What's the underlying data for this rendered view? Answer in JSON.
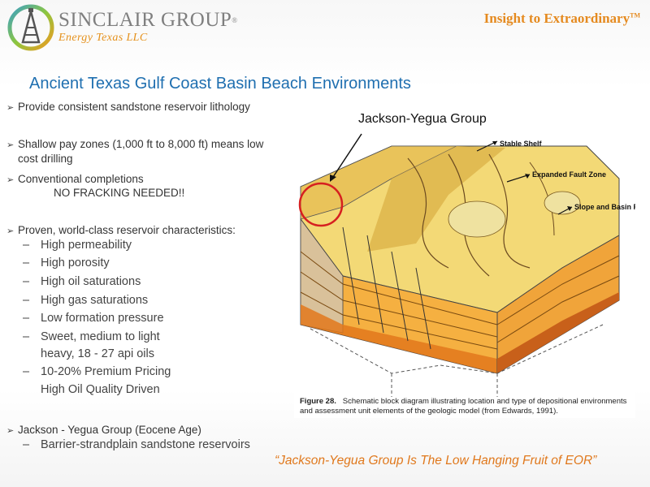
{
  "header": {
    "company_name": "SINCLAIR GROUP",
    "company_reg": "®",
    "company_sub": "Energy Texas LLC",
    "tagline": "Insight to Extraordinary",
    "tagline_tm": "TM"
  },
  "title": "Ancient Texas Gulf Coast Basin Beach Environments",
  "bullets": {
    "b1": "Provide consistent sandstone reservoir lithology",
    "b2_line1": "Shallow pay zones (1,000 ft to 8,000 ft) means low",
    "b2_line2": "cost drilling",
    "b3_line1": "Conventional completions",
    "b3_line2": "NO FRACKING NEEDED!!",
    "b4": "Proven, world-class reservoir characteristics:",
    "sub": [
      "High permeability",
      "High porosity",
      "High oil saturations",
      "High gas saturations",
      "Low formation pressure",
      "Sweet, medium to light",
      "heavy, 18 - 27 api oils",
      "10-20% Premium Pricing",
      "High Oil Quality Driven"
    ],
    "b5": "Jackson - Yegua Group (Eocene Age)",
    "b5_sub": "Barrier-strandplain sandstone reservoirs"
  },
  "figure": {
    "callout_label": "Jackson-Yegua Group",
    "labels": {
      "stable_shelf": "Stable Shelf",
      "expanded_fault_zone": "Expanded Fault Zone",
      "slope_basin_floor": "Slope and Basin Floor"
    },
    "caption_bold": "Figure 28.",
    "caption_text": "Schematic block diagram illustrating location and type of depositional environments and assessment unit elements of the geologic model (from Edwards, 1991)."
  },
  "quote": "“Jackson-Yegua Group Is The Low Hanging Fruit of EOR”",
  "colors": {
    "title_blue": "#1f6fb0",
    "accent_orange": "#e58a1f",
    "callout_red": "#d62020"
  }
}
